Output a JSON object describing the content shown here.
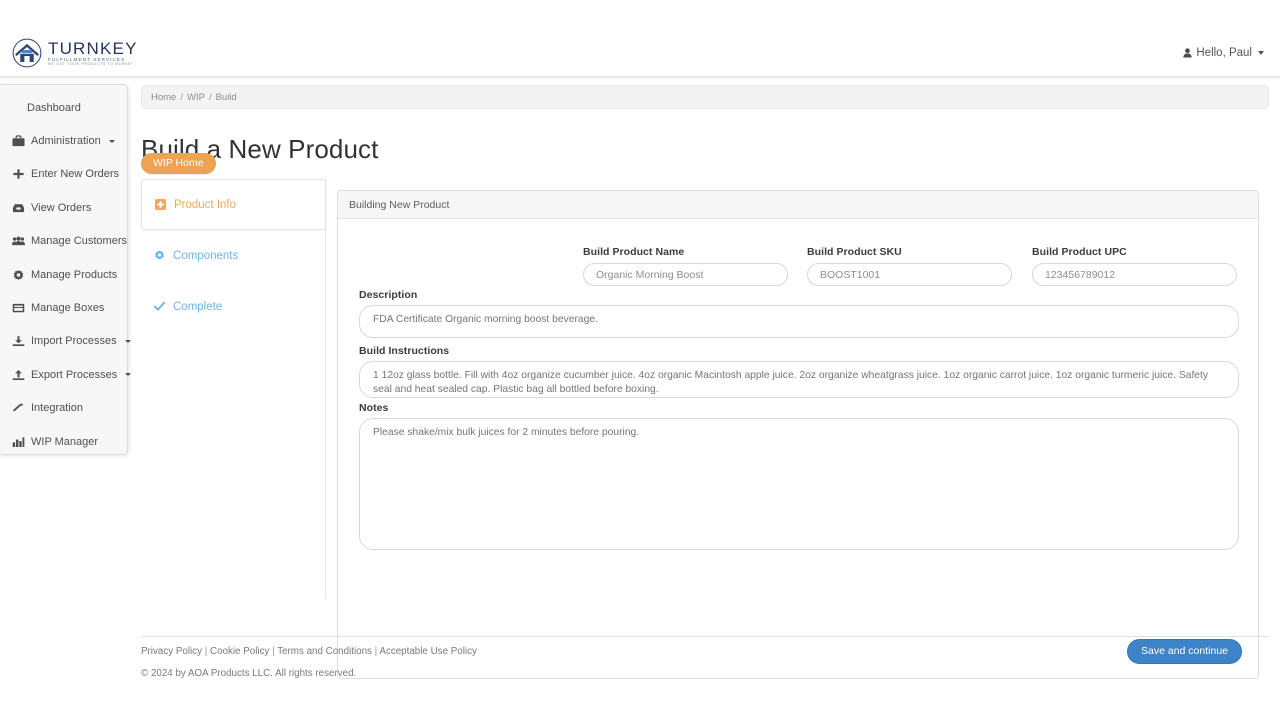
{
  "brand": {
    "name": "TURNKEY",
    "tagline": "FULFILLMENT SERVICES",
    "tagline2": "WE GET YOUR PRODUCTS TO MARKET",
    "logo_icon": "warehouse-logo-icon",
    "logo_color": "#24355c"
  },
  "topbar": {
    "user_greeting": "Hello, Paul",
    "user_icon": "user-icon",
    "caret_icon": "caret-down-icon"
  },
  "sidebar": {
    "items": [
      {
        "label": "Dashboard",
        "icon": "",
        "caret": false
      },
      {
        "label": "Administration",
        "icon": "briefcase-icon",
        "caret": true
      },
      {
        "label": "Enter New Orders",
        "icon": "plus-icon",
        "caret": false
      },
      {
        "label": "View Orders",
        "icon": "inbox-icon",
        "caret": false
      },
      {
        "label": "Manage Customers",
        "icon": "users-icon",
        "caret": false
      },
      {
        "label": "Manage Products",
        "icon": "gear-icon",
        "caret": false
      },
      {
        "label": "Manage Boxes",
        "icon": "box-icon",
        "caret": false
      },
      {
        "label": "Import Processes",
        "icon": "download-icon",
        "caret": true
      },
      {
        "label": "Export Processes",
        "icon": "upload-icon",
        "caret": true
      },
      {
        "label": "Integration",
        "icon": "magic-wand-icon",
        "caret": false
      },
      {
        "label": "WIP Manager",
        "icon": "chart-bar-icon",
        "caret": false
      }
    ]
  },
  "breadcrumb": {
    "items": [
      "Home",
      "WIP",
      "Build"
    ],
    "separator": "/"
  },
  "page": {
    "title": "Build a New Product",
    "wip_home_label": "WIP Home",
    "wip_home_color": "#eda354"
  },
  "steps": [
    {
      "label": "Product Info",
      "icon": "plus-square-icon",
      "state": "active",
      "color": "#f0a860"
    },
    {
      "label": "Components",
      "icon": "gear-icon",
      "state": "pending",
      "color": "#6fb5e4"
    },
    {
      "label": "Complete",
      "icon": "check-icon",
      "state": "pending",
      "color": "#6fb5e4"
    }
  ],
  "panel": {
    "header": "Building New Product",
    "fields": {
      "product_name": {
        "label": "Build Product Name",
        "value": "Organic Morning Boost",
        "placeholder": "Organic Morning Boost"
      },
      "product_sku": {
        "label": "Build Product SKU",
        "value": "BOOST1001",
        "placeholder": "BOOST1001"
      },
      "product_upc": {
        "label": "Build Product UPC",
        "value": "123456789012",
        "placeholder": "123456789012"
      },
      "description": {
        "label": "Description",
        "value": "FDA Certificate Organic morning boost beverage.",
        "placeholder": "FDA Certificate Organic morning boost beverage."
      },
      "build_instructions": {
        "label": "Build Instructions",
        "value": "1 12oz glass bottle. Fill with 4oz organize cucumber juice. 4oz organic Macintosh apple juice. 2oz organize wheatgrass juice. 1oz organic carrot juice. 1oz organic turmeric juice. Safety seal and heat sealed cap. Plastic bag all bottled before boxing.",
        "placeholder": "1 12oz glass bottle. Fill with 4oz organize cucumber juice. 4oz organic Macintosh apple juice. 2oz organize wheatgrass juice. 1oz organic carrot juice. 1oz organic turmeric juice. Safety seal and heat sealed cap. Plastic bag all bottled before boxing."
      },
      "notes": {
        "label": "Notes",
        "value": "Please shake/mix bulk juices for 2 minutes before pouring.",
        "placeholder": "Please shake/mix bulk juices for 2 minutes before pouring."
      }
    },
    "save_label": "Save and continue",
    "save_color": "#3d83c7"
  },
  "footer": {
    "links": [
      "Privacy Policy",
      "Cookie Policy",
      "Terms and Conditions",
      "Acceptable Use Policy"
    ],
    "separator": "|",
    "copyright": "© 2024 by AOA Products LLC. All rights reserved."
  }
}
